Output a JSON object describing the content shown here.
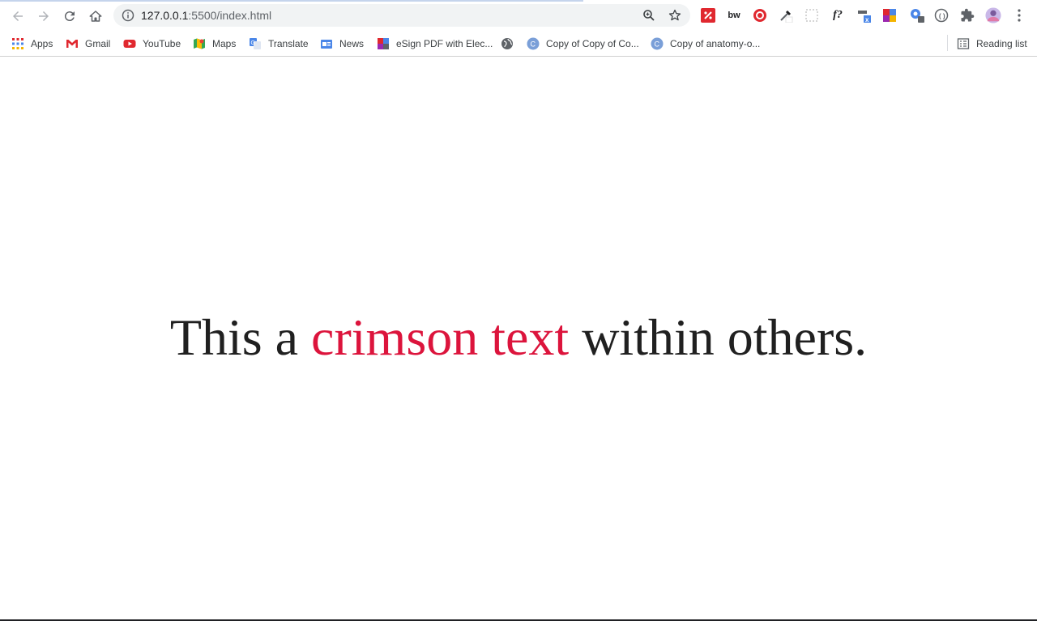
{
  "toolbar": {
    "url_host": "127.0.0.1",
    "url_rest": ":5500/index.html",
    "icons": [
      "back-icon",
      "forward-icon",
      "reload-icon",
      "home-icon",
      "info-icon",
      "zoom-icon",
      "star-icon",
      "menu-icon"
    ],
    "extensions": {
      "bw": "bw",
      "fq": "f?"
    }
  },
  "bookmarks": [
    {
      "label": "Apps",
      "icon": "apps-icon"
    },
    {
      "label": "Gmail",
      "icon": "gmail-icon"
    },
    {
      "label": "YouTube",
      "icon": "youtube-icon"
    },
    {
      "label": "Maps",
      "icon": "maps-icon"
    },
    {
      "label": "Translate",
      "icon": "translate-icon"
    },
    {
      "label": "News",
      "icon": "news-icon"
    },
    {
      "label": "eSign PDF with Elec...",
      "icon": "esign-icon"
    },
    {
      "label": "",
      "icon": "globe-icon"
    },
    {
      "label": "Copy of Copy of Co...",
      "icon": "doc-icon"
    },
    {
      "label": "Copy of anatomy-o...",
      "icon": "doc-icon"
    }
  ],
  "reading_list": "Reading list",
  "content": {
    "before": "This a ",
    "crimson": "crimson text",
    "after": " within others.",
    "accent_color": "#dc143c"
  }
}
